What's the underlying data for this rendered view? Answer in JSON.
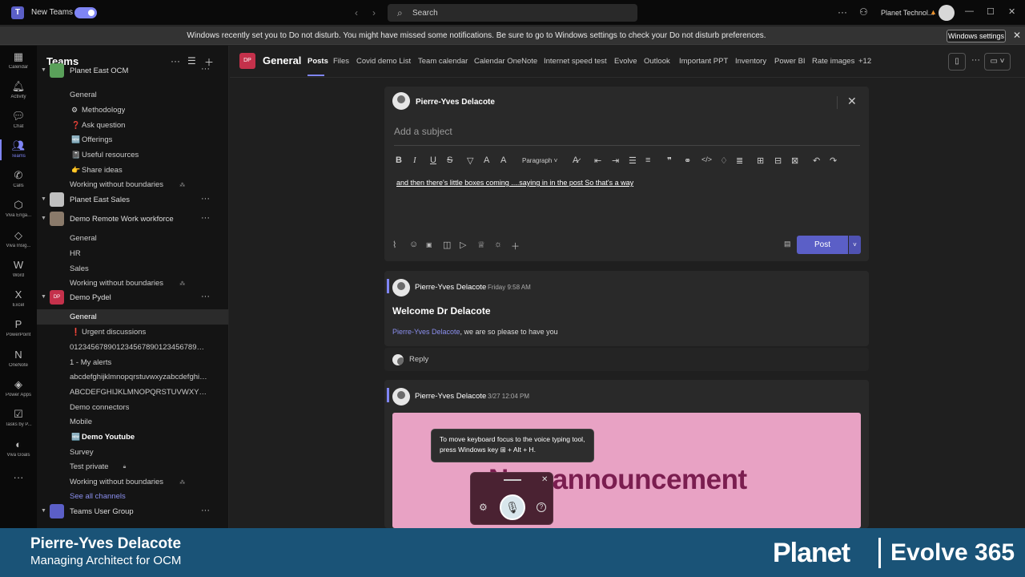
{
  "titlebar": {
    "app_icon": "teams-logo-icon",
    "new_teams": "New Teams",
    "search_placeholder": "Search",
    "org": "Planet Technol...",
    "window_controls": [
      "—",
      "☐",
      "✕"
    ]
  },
  "dnd_banner": {
    "message": "Windows recently set you to Do not disturb. You might have missed some notifications. Be sure to go to Windows settings to check your Do not disturb preferences.",
    "button": "Windows settings"
  },
  "rail": [
    {
      "label": "Calendar",
      "icon": "calendar-icon",
      "glyph": "▦"
    },
    {
      "label": "Activity",
      "icon": "bell-icon",
      "glyph": "🔔︎"
    },
    {
      "label": "Chat",
      "icon": "chat-icon",
      "glyph": "💬︎"
    },
    {
      "label": "Teams",
      "icon": "teams-icon",
      "glyph": "👥︎",
      "active": true
    },
    {
      "label": "Calls",
      "icon": "phone-icon",
      "glyph": "✆"
    },
    {
      "label": "Viva Enga...",
      "icon": "viva-engage-icon",
      "glyph": "⬡"
    },
    {
      "label": "Viva Insig...",
      "icon": "viva-insights-icon",
      "glyph": "◇"
    },
    {
      "label": "Word",
      "icon": "word-icon",
      "glyph": "W"
    },
    {
      "label": "Excel",
      "icon": "excel-icon",
      "glyph": "X"
    },
    {
      "label": "PowerPoint",
      "icon": "powerpoint-icon",
      "glyph": "P"
    },
    {
      "label": "OneNote",
      "icon": "onenote-icon",
      "glyph": "N"
    },
    {
      "label": "Power Apps",
      "icon": "power-apps-icon",
      "glyph": "◈"
    },
    {
      "label": "Tasks by P...",
      "icon": "tasks-icon",
      "glyph": "☑"
    },
    {
      "label": "Viva Goals",
      "icon": "viva-goals-icon",
      "glyph": "◐"
    },
    {
      "label": "",
      "icon": "more-apps-icon",
      "glyph": "···"
    }
  ],
  "panel": {
    "title": "Teams",
    "items": [
      {
        "kind": "team",
        "text": "Planet East OCM",
        "partial": true
      },
      {
        "kind": "chan",
        "text": "General"
      },
      {
        "kind": "chan",
        "text": "Methodology",
        "icon": "⚙"
      },
      {
        "kind": "chan",
        "text": "Ask question",
        "icon": "❓"
      },
      {
        "kind": "chan",
        "text": "Offerings",
        "icon": "🆕"
      },
      {
        "kind": "chan",
        "text": "Useful resources",
        "icon": "📓"
      },
      {
        "kind": "chan",
        "text": "Share ideas",
        "icon": "👉"
      },
      {
        "kind": "chan",
        "text": "Working without boundaries",
        "suffix": "⁂"
      },
      {
        "kind": "team",
        "text": "Planet East Sales"
      },
      {
        "kind": "team",
        "text": "Demo Remote Work workforce"
      },
      {
        "kind": "chan",
        "text": "General"
      },
      {
        "kind": "chan",
        "text": "HR"
      },
      {
        "kind": "chan",
        "text": "Sales"
      },
      {
        "kind": "chan",
        "text": "Working without boundaries",
        "suffix": "⁂"
      },
      {
        "kind": "team",
        "text": "Demo Pydel",
        "avatar": "DP"
      },
      {
        "kind": "chan",
        "text": "General",
        "selected": true
      },
      {
        "kind": "chan",
        "text": "Urgent discussions",
        "icon": "❗"
      },
      {
        "kind": "chan",
        "text": "0123456789012345678901234567890123456789012..."
      },
      {
        "kind": "chan",
        "text": "1 - My alerts"
      },
      {
        "kind": "chan",
        "text": "abcdefghijklmnopqrstuvwxyzabcdefghijklmnopqrstuvwxyz"
      },
      {
        "kind": "chan",
        "text": "ABCDEFGHIJKLMNOPQRSTUVWXYZABCDEFGHIJKLMNOPQRSTUVWXYZ"
      },
      {
        "kind": "chan",
        "text": "Demo connectors"
      },
      {
        "kind": "chan",
        "text": "Mobile"
      },
      {
        "kind": "chan",
        "text": "Demo Youtube",
        "icon": "🆕",
        "bold": true
      },
      {
        "kind": "chan",
        "text": "Survey"
      },
      {
        "kind": "chan",
        "text": "Test private",
        "suffix": "🔒︎"
      },
      {
        "kind": "chan",
        "text": "Working without boundaries",
        "suffix": "⁂"
      },
      {
        "kind": "chan",
        "text": "See all channels",
        "link": true
      },
      {
        "kind": "team",
        "text": "Teams User Group"
      }
    ]
  },
  "channel": {
    "avatar": "DP",
    "name": "General",
    "tabs": [
      "Posts",
      "Files",
      "Covid demo List",
      "Team calendar",
      "Calendar OneNote",
      "Internet speed test",
      "Evolve",
      "Outlook",
      "Important PPT",
      "Inventory",
      "Power BI",
      "Rate images",
      "+12"
    ]
  },
  "compose": {
    "author": "Pierre-Yves Delacote",
    "subject_placeholder": "Add a subject",
    "paragraph_label": "Paragraph",
    "body": "and then there's little boxes coming ....saying in in the post So that's a way",
    "post_label": "Post"
  },
  "messages": [
    {
      "author": "Pierre-Yves Delacote",
      "time": "Friday 9:58 AM",
      "title": "Welcome Dr Delacote",
      "mention": "Pierre-Yves Delacote",
      "text": ", we are so please to have you",
      "reply": "Reply"
    },
    {
      "author": "Pierre-Yves Delacote",
      "time": "3/27 12:04 PM",
      "image_text": "New announcement"
    }
  ],
  "voice": {
    "tooltip": "To move keyboard focus to the voice typing tool, press Windows key ⊞ + Alt + H."
  },
  "lower_third": {
    "name": "Pierre-Yves Delacote",
    "role": "Managing Architect for OCM",
    "brand": "Planet",
    "product": "Evolve 365"
  },
  "colors": {
    "accent": "#7f85f5",
    "brand_blue": "#1a5377",
    "post_button": "#5b5fc7",
    "announcement_bg": "#e8a2c4"
  }
}
